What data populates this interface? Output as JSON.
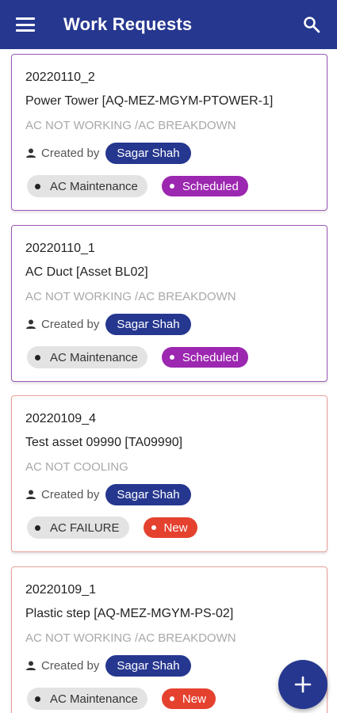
{
  "header": {
    "title": "Work Requests",
    "menu_icon": "menu-icon",
    "search_icon": "search-icon"
  },
  "requests": [
    {
      "id": "20220110_2",
      "asset": "Power Tower [AQ-MEZ-MGYM-PTOWER-1]",
      "description": "AC NOT WORKING /AC BREAKDOWN",
      "created_by_label": "Created by",
      "created_by": "Sagar Shah",
      "category": "AC Maintenance",
      "status": "Scheduled"
    },
    {
      "id": "20220110_1",
      "asset": "AC Duct [Asset BL02]",
      "description": "AC NOT WORKING /AC BREAKDOWN",
      "created_by_label": "Created by",
      "created_by": "Sagar Shah",
      "category": "AC Maintenance",
      "status": "Scheduled"
    },
    {
      "id": "20220109_4",
      "asset": "Test asset 09990 [TA09990]",
      "description": "AC NOT COOLING",
      "created_by_label": "Created by",
      "created_by": "Sagar Shah",
      "category": "AC FAILURE",
      "status": "New"
    },
    {
      "id": "20220109_1",
      "asset": "Plastic step [AQ-MEZ-MGYM-PS-02]",
      "description": "AC NOT WORKING /AC BREAKDOWN",
      "created_by_label": "Created by",
      "created_by": "Sagar Shah",
      "category": "AC Maintenance",
      "status": "New"
    }
  ],
  "fab": {
    "icon": "plus-icon"
  },
  "colors": {
    "primary": "#26378f",
    "scheduled": "#9c27b0",
    "new": "#e5412f",
    "card_border_scheduled": "#9b59b6",
    "card_border_new": "#e8a09a"
  }
}
